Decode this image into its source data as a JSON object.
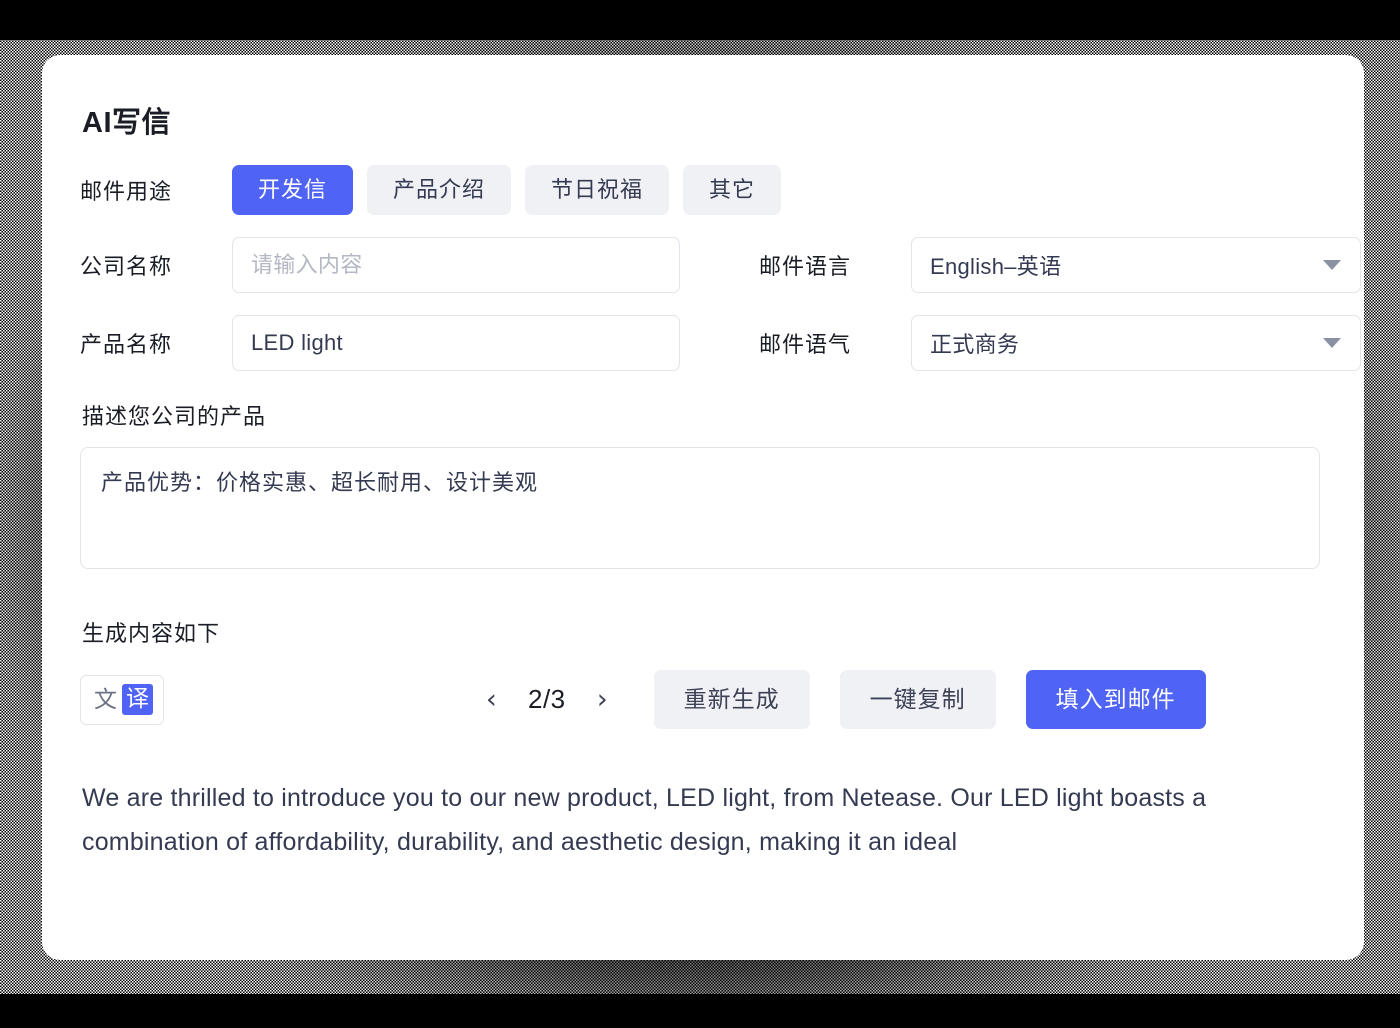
{
  "page": {
    "title": "AI写信"
  },
  "purpose": {
    "label": "邮件用途",
    "tabs": [
      {
        "label": "开发信",
        "active": true
      },
      {
        "label": "产品介绍",
        "active": false
      },
      {
        "label": "节日祝福",
        "active": false
      },
      {
        "label": "其它",
        "active": false
      }
    ]
  },
  "fields": {
    "company": {
      "label": "公司名称",
      "value": "",
      "placeholder": "请输入内容"
    },
    "product": {
      "label": "产品名称",
      "value": "LED light",
      "placeholder": "请输入内容"
    },
    "language": {
      "label": "邮件语言",
      "value": "English–英语"
    },
    "tone": {
      "label": "邮件语气",
      "value": "正式商务"
    }
  },
  "description": {
    "label": "描述您公司的产品",
    "value": "产品优势：价格实惠、超长耐用、设计美观",
    "placeholder": "请输入内容"
  },
  "result": {
    "label": "生成内容如下",
    "translate_icon": {
      "source_char": "文",
      "target_char": "译"
    },
    "pager": {
      "prev": "‹",
      "next": "›",
      "count": "2/3",
      "current": 2,
      "total": 3
    },
    "actions": {
      "regenerate": "重新生成",
      "copy": "一键复制",
      "fill": "填入到邮件"
    },
    "output": "We are thrilled to introduce you to our new product, LED light, from Netease. Our LED light boasts a combination of affordability, durability, and aesthetic design, making it an ideal"
  },
  "colors": {
    "accent": "#4F63F5",
    "chip_bg": "#F0F1F5",
    "text": "#343A51",
    "heading": "#1B1D26",
    "border": "#E2E4EA",
    "placeholder": "#B4B8C4",
    "backdrop": "#000000",
    "card": "#FFFFFF"
  }
}
